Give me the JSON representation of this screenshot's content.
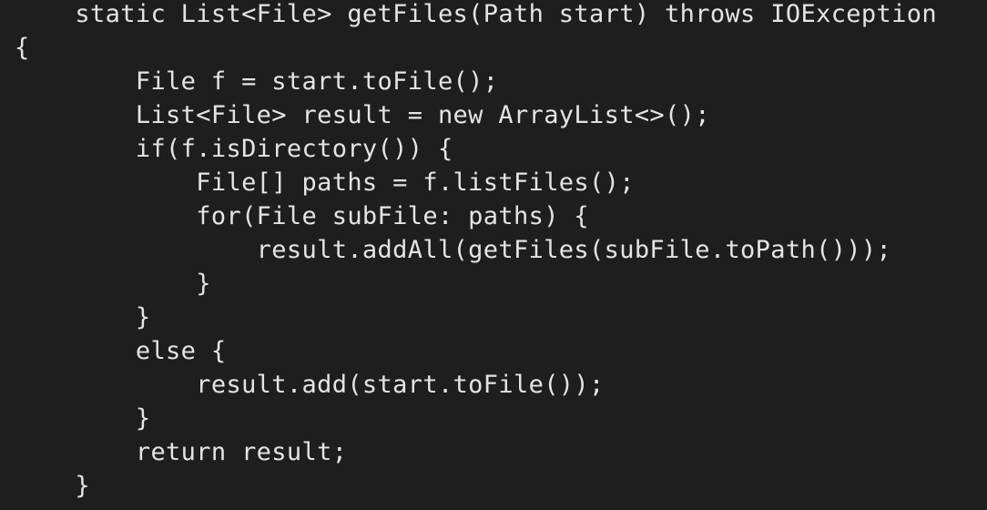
{
  "editor": {
    "language": "java",
    "lines": [
      "    static List<File> getFiles(Path start) throws IOException",
      "{",
      "        File f = start.toFile();",
      "        List<File> result = new ArrayList<>();",
      "        if(f.isDirectory()) {",
      "            File[] paths = f.listFiles();",
      "            for(File subFile: paths) {",
      "                result.addAll(getFiles(subFile.toPath()));",
      "            }",
      "        }",
      "        else {",
      "            result.add(start.toFile());",
      "        }",
      "        return result;",
      "    }"
    ]
  },
  "colors": {
    "background": "#1e1e1e",
    "text": "#e4e4e4"
  }
}
